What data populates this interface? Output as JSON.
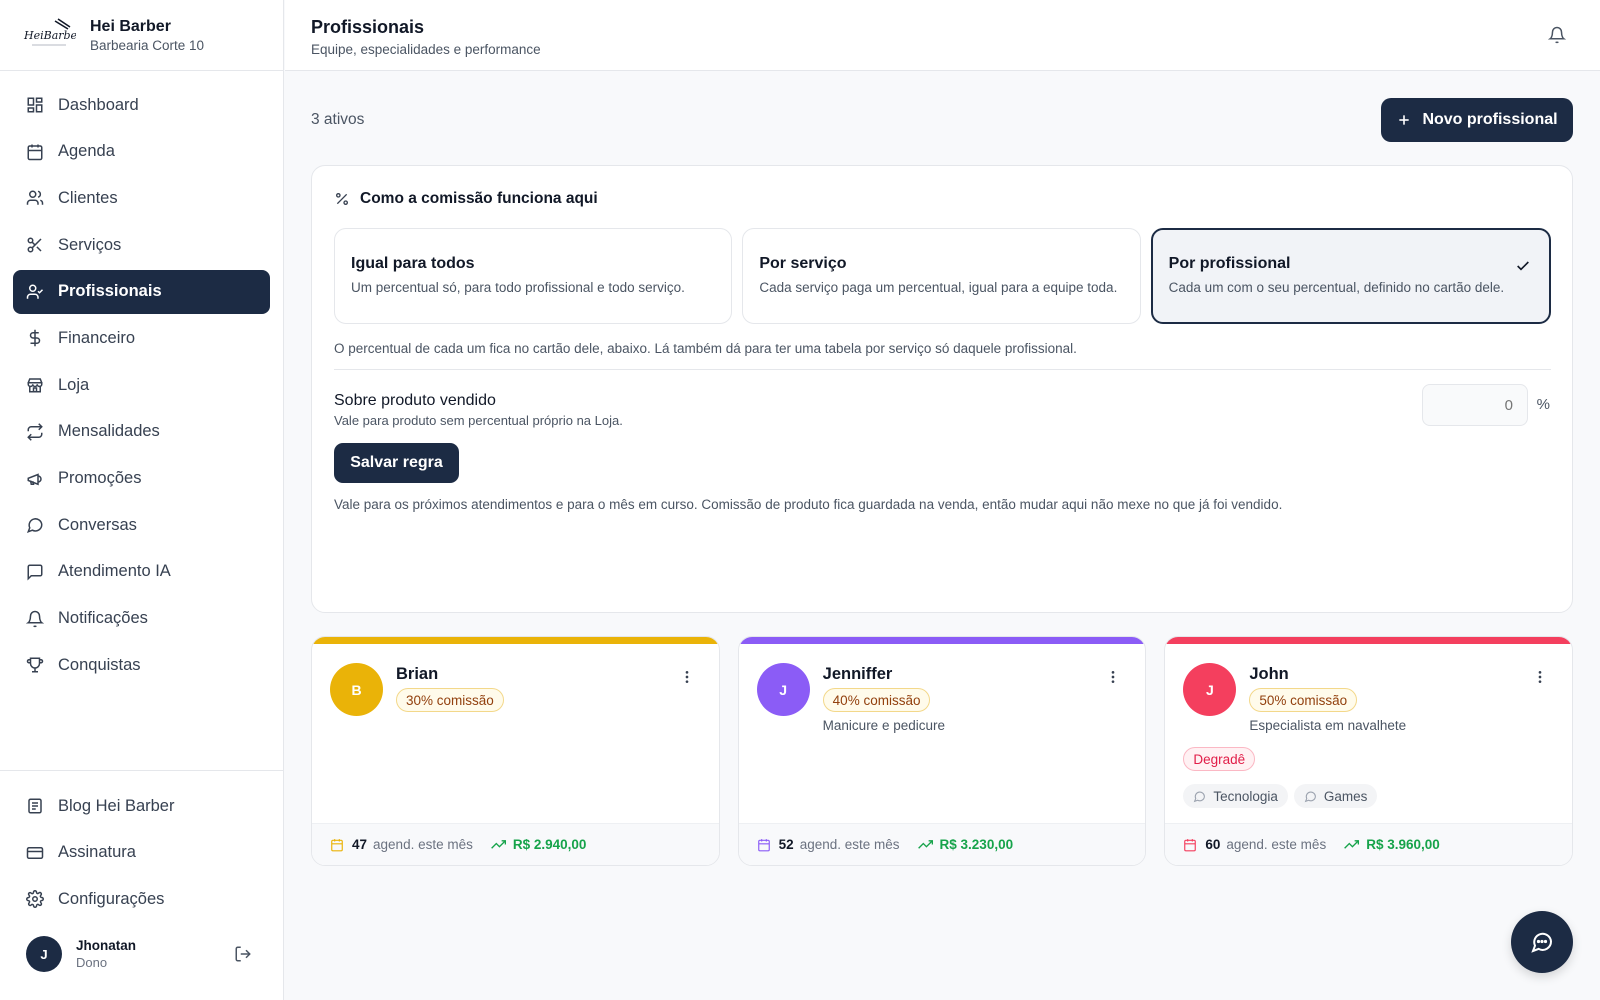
{
  "brand": {
    "name": "Hei Barber",
    "subtitle": "Barbearia Corte 10",
    "logo_text": "HeiBarber"
  },
  "sidebar": {
    "items": [
      {
        "label": "Dashboard",
        "icon": "grid-icon"
      },
      {
        "label": "Agenda",
        "icon": "calendar-icon"
      },
      {
        "label": "Clientes",
        "icon": "users-icon"
      },
      {
        "label": "Serviços",
        "icon": "scissors-icon"
      },
      {
        "label": "Profissionais",
        "icon": "user-check-icon",
        "active": true
      },
      {
        "label": "Financeiro",
        "icon": "dollar-icon"
      },
      {
        "label": "Loja",
        "icon": "store-icon"
      },
      {
        "label": "Mensalidades",
        "icon": "repeat-icon"
      },
      {
        "label": "Promoções",
        "icon": "megaphone-icon"
      },
      {
        "label": "Conversas",
        "icon": "message-circle-icon"
      },
      {
        "label": "Atendimento IA",
        "icon": "message-square-icon"
      },
      {
        "label": "Notificações",
        "icon": "bell-icon"
      },
      {
        "label": "Conquistas",
        "icon": "trophy-icon"
      }
    ],
    "bottom_items": [
      {
        "label": "Blog Hei Barber",
        "icon": "newspaper-icon"
      },
      {
        "label": "Assinatura",
        "icon": "credit-card-icon"
      },
      {
        "label": "Configurações",
        "icon": "gear-icon"
      }
    ],
    "user": {
      "initial": "J",
      "name": "Jhonatan",
      "role": "Dono"
    }
  },
  "header": {
    "title": "Profissionais",
    "subtitle": "Equipe, especialidades e performance"
  },
  "toolbar": {
    "count": "3 ativos",
    "new_button": "Novo profissional"
  },
  "commission": {
    "title": "Como a comissão funciona aqui",
    "options": [
      {
        "title": "Igual para todos",
        "desc": "Um percentual só, para todo profissional e todo serviço.",
        "selected": false
      },
      {
        "title": "Por serviço",
        "desc": "Cada serviço paga um percentual, igual para a equipe toda.",
        "selected": false
      },
      {
        "title": "Por profissional",
        "desc": "Cada um com o seu percentual, definido no cartão dele.",
        "selected": true
      }
    ],
    "note": "O percentual de cada um fica no cartão dele, abaixo. Lá também dá para ter uma tabela por serviço só daquele profissional.",
    "product_title": "Sobre produto vendido",
    "product_sub": "Vale para produto sem percentual próprio na Loja.",
    "product_value": "0",
    "product_unit": "%",
    "save_button": "Salvar regra",
    "save_note": "Vale para os próximos atendimentos e para o mês em curso. Comissão de produto fica guardada na venda, então mudar aqui não mexe no que já foi vendido."
  },
  "professionals": [
    {
      "initial": "B",
      "name": "Brian",
      "commission": "30% comissão",
      "description": "",
      "specialty": "",
      "tags": [],
      "color": "#eab308",
      "appointments": "47",
      "appointments_label": "agend. este mês",
      "revenue": "R$ 2.940,00"
    },
    {
      "initial": "J",
      "name": "Jenniffer",
      "commission": "40% comissão",
      "description": "Manicure e pedicure",
      "specialty": "",
      "tags": [],
      "color": "#8b5cf6",
      "appointments": "52",
      "appointments_label": "agend. este mês",
      "revenue": "R$ 3.230,00"
    },
    {
      "initial": "J",
      "name": "John",
      "commission": "50% comissão",
      "description": "Especialista em navalhete",
      "specialty": "Degradê",
      "tags": [
        "Tecnologia",
        "Games"
      ],
      "color": "#f43f5e",
      "appointments": "60",
      "appointments_label": "agend. este mês",
      "revenue": "R$ 3.960,00"
    }
  ],
  "colors": {
    "primary": "#1c2b44",
    "success": "#16a34a",
    "muted": "#4b5563"
  }
}
